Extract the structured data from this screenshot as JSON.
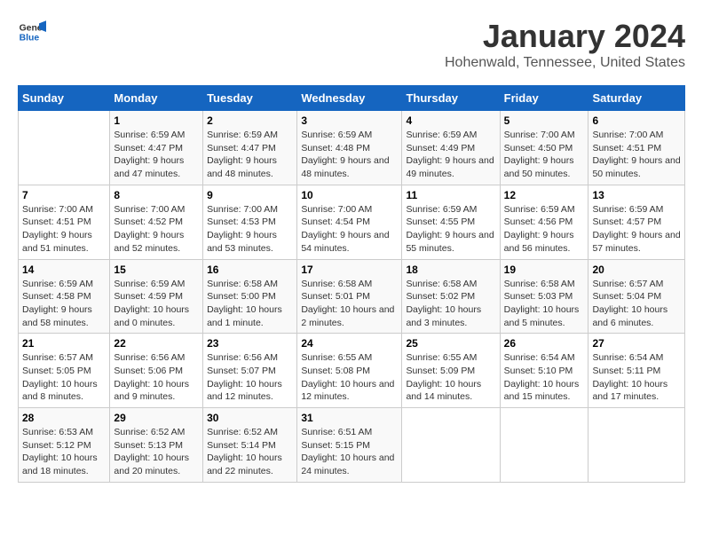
{
  "logo": {
    "line1": "General",
    "line2": "Blue"
  },
  "title": "January 2024",
  "subtitle": "Hohenwald, Tennessee, United States",
  "days_of_week": [
    "Sunday",
    "Monday",
    "Tuesday",
    "Wednesday",
    "Thursday",
    "Friday",
    "Saturday"
  ],
  "weeks": [
    [
      {
        "num": "",
        "sunrise": "",
        "sunset": "",
        "daylight": ""
      },
      {
        "num": "1",
        "sunrise": "Sunrise: 6:59 AM",
        "sunset": "Sunset: 4:47 PM",
        "daylight": "Daylight: 9 hours and 47 minutes."
      },
      {
        "num": "2",
        "sunrise": "Sunrise: 6:59 AM",
        "sunset": "Sunset: 4:47 PM",
        "daylight": "Daylight: 9 hours and 48 minutes."
      },
      {
        "num": "3",
        "sunrise": "Sunrise: 6:59 AM",
        "sunset": "Sunset: 4:48 PM",
        "daylight": "Daylight: 9 hours and 48 minutes."
      },
      {
        "num": "4",
        "sunrise": "Sunrise: 6:59 AM",
        "sunset": "Sunset: 4:49 PM",
        "daylight": "Daylight: 9 hours and 49 minutes."
      },
      {
        "num": "5",
        "sunrise": "Sunrise: 7:00 AM",
        "sunset": "Sunset: 4:50 PM",
        "daylight": "Daylight: 9 hours and 50 minutes."
      },
      {
        "num": "6",
        "sunrise": "Sunrise: 7:00 AM",
        "sunset": "Sunset: 4:51 PM",
        "daylight": "Daylight: 9 hours and 50 minutes."
      }
    ],
    [
      {
        "num": "7",
        "sunrise": "Sunrise: 7:00 AM",
        "sunset": "Sunset: 4:51 PM",
        "daylight": "Daylight: 9 hours and 51 minutes."
      },
      {
        "num": "8",
        "sunrise": "Sunrise: 7:00 AM",
        "sunset": "Sunset: 4:52 PM",
        "daylight": "Daylight: 9 hours and 52 minutes."
      },
      {
        "num": "9",
        "sunrise": "Sunrise: 7:00 AM",
        "sunset": "Sunset: 4:53 PM",
        "daylight": "Daylight: 9 hours and 53 minutes."
      },
      {
        "num": "10",
        "sunrise": "Sunrise: 7:00 AM",
        "sunset": "Sunset: 4:54 PM",
        "daylight": "Daylight: 9 hours and 54 minutes."
      },
      {
        "num": "11",
        "sunrise": "Sunrise: 6:59 AM",
        "sunset": "Sunset: 4:55 PM",
        "daylight": "Daylight: 9 hours and 55 minutes."
      },
      {
        "num": "12",
        "sunrise": "Sunrise: 6:59 AM",
        "sunset": "Sunset: 4:56 PM",
        "daylight": "Daylight: 9 hours and 56 minutes."
      },
      {
        "num": "13",
        "sunrise": "Sunrise: 6:59 AM",
        "sunset": "Sunset: 4:57 PM",
        "daylight": "Daylight: 9 hours and 57 minutes."
      }
    ],
    [
      {
        "num": "14",
        "sunrise": "Sunrise: 6:59 AM",
        "sunset": "Sunset: 4:58 PM",
        "daylight": "Daylight: 9 hours and 58 minutes."
      },
      {
        "num": "15",
        "sunrise": "Sunrise: 6:59 AM",
        "sunset": "Sunset: 4:59 PM",
        "daylight": "Daylight: 10 hours and 0 minutes."
      },
      {
        "num": "16",
        "sunrise": "Sunrise: 6:58 AM",
        "sunset": "Sunset: 5:00 PM",
        "daylight": "Daylight: 10 hours and 1 minute."
      },
      {
        "num": "17",
        "sunrise": "Sunrise: 6:58 AM",
        "sunset": "Sunset: 5:01 PM",
        "daylight": "Daylight: 10 hours and 2 minutes."
      },
      {
        "num": "18",
        "sunrise": "Sunrise: 6:58 AM",
        "sunset": "Sunset: 5:02 PM",
        "daylight": "Daylight: 10 hours and 3 minutes."
      },
      {
        "num": "19",
        "sunrise": "Sunrise: 6:58 AM",
        "sunset": "Sunset: 5:03 PM",
        "daylight": "Daylight: 10 hours and 5 minutes."
      },
      {
        "num": "20",
        "sunrise": "Sunrise: 6:57 AM",
        "sunset": "Sunset: 5:04 PM",
        "daylight": "Daylight: 10 hours and 6 minutes."
      }
    ],
    [
      {
        "num": "21",
        "sunrise": "Sunrise: 6:57 AM",
        "sunset": "Sunset: 5:05 PM",
        "daylight": "Daylight: 10 hours and 8 minutes."
      },
      {
        "num": "22",
        "sunrise": "Sunrise: 6:56 AM",
        "sunset": "Sunset: 5:06 PM",
        "daylight": "Daylight: 10 hours and 9 minutes."
      },
      {
        "num": "23",
        "sunrise": "Sunrise: 6:56 AM",
        "sunset": "Sunset: 5:07 PM",
        "daylight": "Daylight: 10 hours and 12 minutes."
      },
      {
        "num": "24",
        "sunrise": "Sunrise: 6:55 AM",
        "sunset": "Sunset: 5:08 PM",
        "daylight": "Daylight: 10 hours and 12 minutes."
      },
      {
        "num": "25",
        "sunrise": "Sunrise: 6:55 AM",
        "sunset": "Sunset: 5:09 PM",
        "daylight": "Daylight: 10 hours and 14 minutes."
      },
      {
        "num": "26",
        "sunrise": "Sunrise: 6:54 AM",
        "sunset": "Sunset: 5:10 PM",
        "daylight": "Daylight: 10 hours and 15 minutes."
      },
      {
        "num": "27",
        "sunrise": "Sunrise: 6:54 AM",
        "sunset": "Sunset: 5:11 PM",
        "daylight": "Daylight: 10 hours and 17 minutes."
      }
    ],
    [
      {
        "num": "28",
        "sunrise": "Sunrise: 6:53 AM",
        "sunset": "Sunset: 5:12 PM",
        "daylight": "Daylight: 10 hours and 18 minutes."
      },
      {
        "num": "29",
        "sunrise": "Sunrise: 6:52 AM",
        "sunset": "Sunset: 5:13 PM",
        "daylight": "Daylight: 10 hours and 20 minutes."
      },
      {
        "num": "30",
        "sunrise": "Sunrise: 6:52 AM",
        "sunset": "Sunset: 5:14 PM",
        "daylight": "Daylight: 10 hours and 22 minutes."
      },
      {
        "num": "31",
        "sunrise": "Sunrise: 6:51 AM",
        "sunset": "Sunset: 5:15 PM",
        "daylight": "Daylight: 10 hours and 24 minutes."
      },
      {
        "num": "",
        "sunrise": "",
        "sunset": "",
        "daylight": ""
      },
      {
        "num": "",
        "sunrise": "",
        "sunset": "",
        "daylight": ""
      },
      {
        "num": "",
        "sunrise": "",
        "sunset": "",
        "daylight": ""
      }
    ]
  ]
}
